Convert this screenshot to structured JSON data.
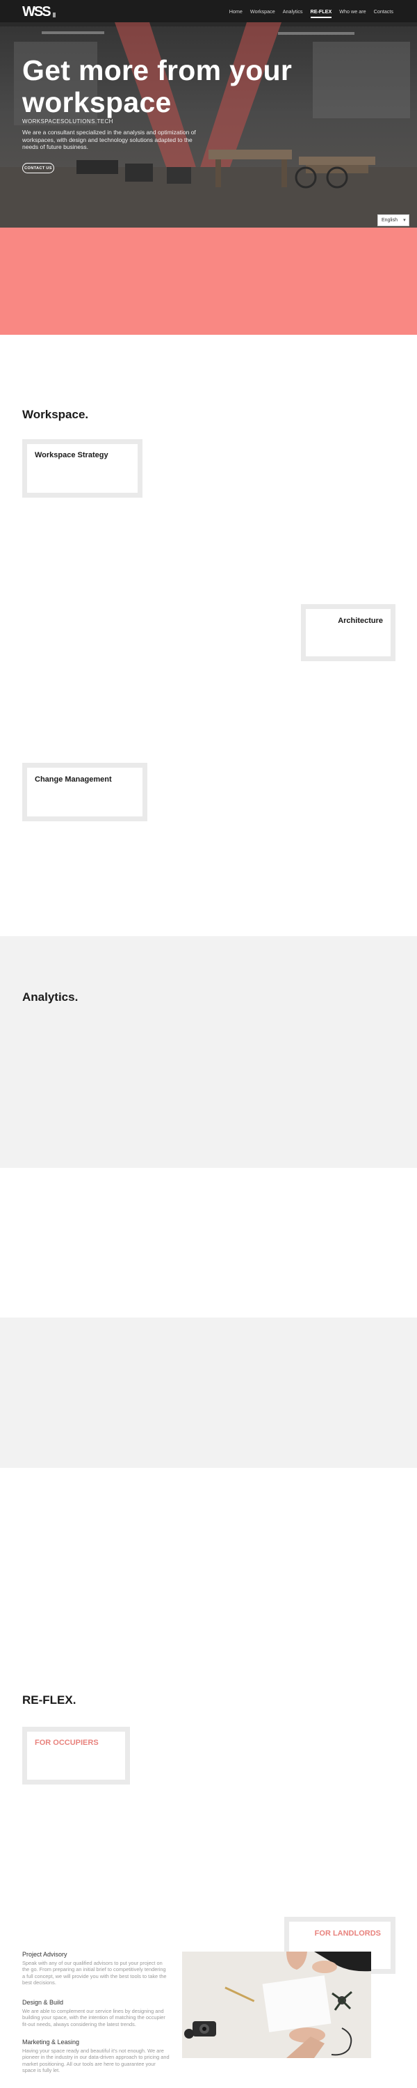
{
  "nav": {
    "logo_text": "WSS",
    "links": [
      {
        "label": "Home"
      },
      {
        "label": "Workspace"
      },
      {
        "label": "Analytics"
      },
      {
        "label": "RE-FLEX"
      },
      {
        "label": "Who we are"
      },
      {
        "label": "Contacts"
      }
    ],
    "active": "RE-FLEX"
  },
  "hero": {
    "title": "Get more from your workspace",
    "subtitle": "WORKSPACESOLUTIONS.TECH",
    "description": "We are a consultant specialized in the analysis and optimization of workspaces, with design and technology solutions adapted to the needs of future business.",
    "cta_label": "CONTACT US"
  },
  "language": {
    "selected": "English",
    "icon": "chevron-down-icon"
  },
  "workspace": {
    "title": "Workspace.",
    "cards": [
      {
        "title": "Workspace Strategy"
      },
      {
        "title": "Architecture"
      },
      {
        "title": "Change Management"
      }
    ]
  },
  "analytics": {
    "title": "Analytics."
  },
  "reflex": {
    "title": "RE-FLEX.",
    "occupiers_label": "FOR OCCUPIERS",
    "landlords_label": "FOR LANDLORDS",
    "services": [
      {
        "heading": "Project Advisory",
        "text": "Speak with any of our qualified advisors to put your project on the go. From preparing an initial brief to competitively tendering a full concept, we will provide you with the best tools to take the best decisions."
      },
      {
        "heading": "Design & Build",
        "text": "We are able to complement our service lines by designing and building your space, with the intention of matching the occupier fit-out needs, always considering the latest trends."
      },
      {
        "heading": "Marketing & Leasing",
        "text": "Having your space ready and beautiful it's not enough. We are pioneer in the industry in our data-driven approach to pricing and market positioning. All our tools are here to guarantee your space is fully let."
      }
    ]
  },
  "colors": {
    "accent": "#f98883",
    "nav_bg": "#1c1c1c",
    "hero_overlay": "#c0504d",
    "band_grey": "#f2f2f2"
  }
}
